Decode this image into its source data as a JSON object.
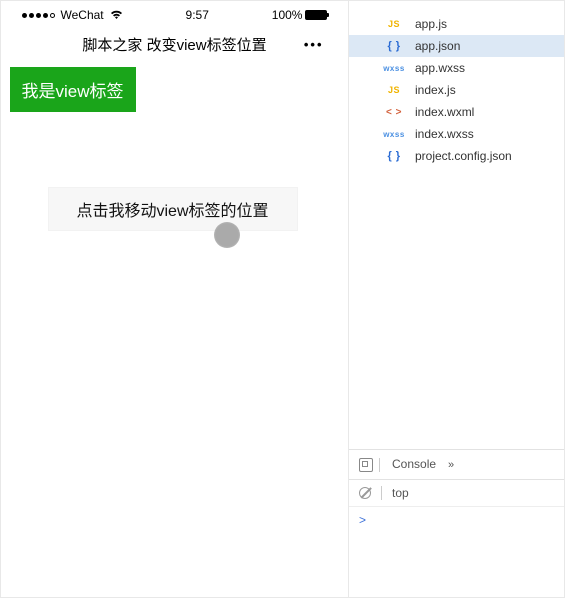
{
  "status": {
    "carrier": "WeChat",
    "time": "9:57",
    "battery_pct": "100%"
  },
  "nav": {
    "title": "脚本之家 改变view标签位置",
    "more": "•••"
  },
  "app": {
    "green_tag_text": "我是view标签",
    "move_button_label": "点击我移动view标签的位置"
  },
  "files": [
    {
      "badge": "JS",
      "badge_class": "badge-js",
      "name": "app.js",
      "selected": false
    },
    {
      "badge": "{ }",
      "badge_class": "badge-json",
      "name": "app.json",
      "selected": true
    },
    {
      "badge": "wxss",
      "badge_class": "badge-wxss",
      "name": "app.wxss",
      "selected": false
    },
    {
      "badge": "JS",
      "badge_class": "badge-js",
      "name": "index.js",
      "selected": false
    },
    {
      "badge": "< >",
      "badge_class": "badge-wxml",
      "name": "index.wxml",
      "selected": false
    },
    {
      "badge": "wxss",
      "badge_class": "badge-wxss",
      "name": "index.wxss",
      "selected": false
    },
    {
      "badge": "{ }",
      "badge_class": "badge-json",
      "name": "project.config.json",
      "selected": false
    }
  ],
  "console": {
    "tab_label": "Console",
    "more": "»",
    "context": "top",
    "prompt": ">"
  }
}
